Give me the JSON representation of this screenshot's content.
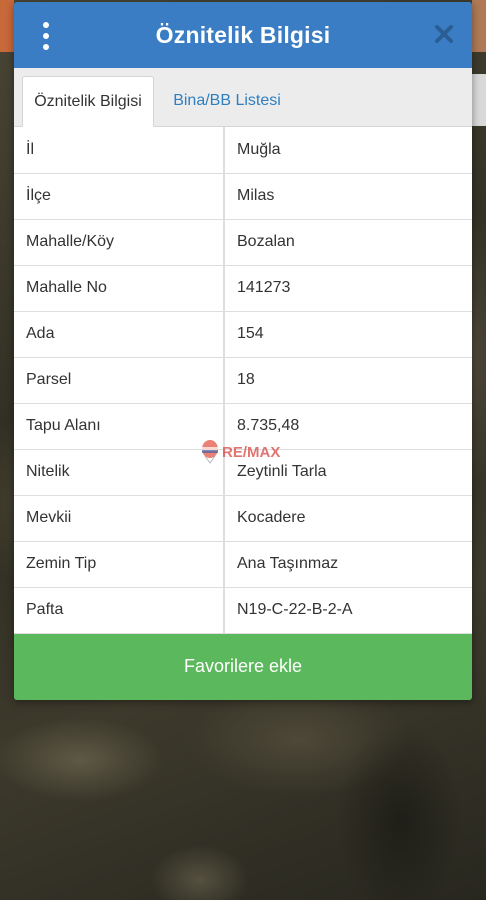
{
  "dialog": {
    "title": "Öznitelik Bilgisi",
    "close_icon": "close-icon",
    "menu_icon": "kebab-menu-icon"
  },
  "tabs": [
    {
      "label": "Öznitelik Bilgisi",
      "active": true
    },
    {
      "label": "Bina/BB Listesi",
      "active": false
    }
  ],
  "attributes": [
    {
      "key": "İl",
      "value": "Muğla"
    },
    {
      "key": "İlçe",
      "value": "Milas"
    },
    {
      "key": "Mahalle/Köy",
      "value": "Bozalan"
    },
    {
      "key": "Mahalle No",
      "value": "141273"
    },
    {
      "key": "Ada",
      "value": "154"
    },
    {
      "key": "Parsel",
      "value": "18"
    },
    {
      "key": "Tapu Alanı",
      "value": "8.735,48"
    },
    {
      "key": "Nitelik",
      "value": "Zeytinli Tarla"
    },
    {
      "key": "Mevkii",
      "value": "Kocadere"
    },
    {
      "key": "Zemin Tip",
      "value": "Ana Taşınmaz"
    },
    {
      "key": "Pafta",
      "value": "N19-C-22-B-2-A"
    }
  ],
  "actions": {
    "favorite_label": "Favorilere ekle"
  },
  "watermark": {
    "text": "RE/MAX"
  },
  "colors": {
    "header": "#3a7dc4",
    "favorite_button": "#5cb85c",
    "tab_link": "#2f7fc1"
  }
}
